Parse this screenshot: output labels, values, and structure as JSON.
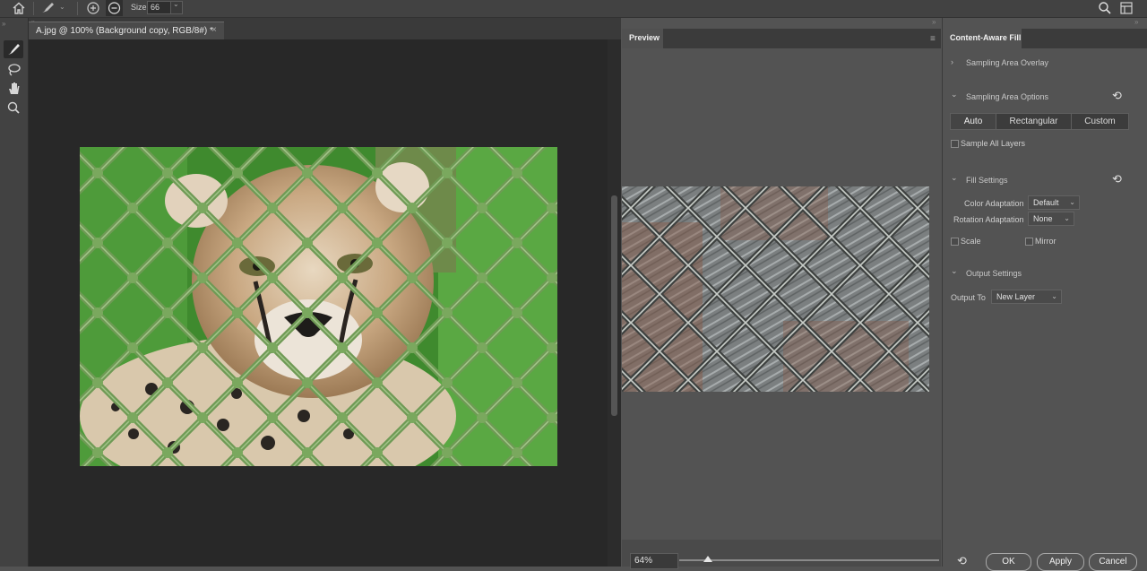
{
  "options_bar": {
    "size_label": "Size",
    "size_value": "66",
    "icons": [
      "home-icon",
      "brush-preset-icon",
      "add-mode-icon",
      "subtract-mode-icon",
      "search-icon",
      "workspace-icon"
    ]
  },
  "tools": [
    "brush-tool-icon",
    "lasso-tool-icon",
    "hand-tool-icon",
    "zoom-tool-icon"
  ],
  "document": {
    "tab_title": "A.jpg @ 100% (Background copy, RGB/8#) *",
    "close_glyph": "×"
  },
  "preview": {
    "tab_label": "Preview",
    "zoom_value": "64%",
    "zoom_fraction": 0.11
  },
  "content_aware_fill": {
    "title": "Content-Aware Fill",
    "sampling_area_overlay": "Sampling Area Overlay",
    "sampling_area_options": "Sampling Area Options",
    "modes": [
      "Auto",
      "Rectangular",
      "Custom"
    ],
    "selected_mode": "Auto",
    "sample_all_layers": "Sample All Layers",
    "fill_settings": "Fill Settings",
    "color_adaptation_label": "Color Adaptation",
    "color_adaptation_value": "Default",
    "rotation_adaptation_label": "Rotation Adaptation",
    "rotation_adaptation_value": "None",
    "scale_label": "Scale",
    "mirror_label": "Mirror",
    "output_settings": "Output Settings",
    "output_to_label": "Output To",
    "output_to_value": "New Layer",
    "ok": "OK",
    "apply": "Apply",
    "cancel": "Cancel"
  },
  "colors": {
    "app_bg": "#535353",
    "canvas_bg": "#282828",
    "fence_green": "#6f9a55"
  }
}
